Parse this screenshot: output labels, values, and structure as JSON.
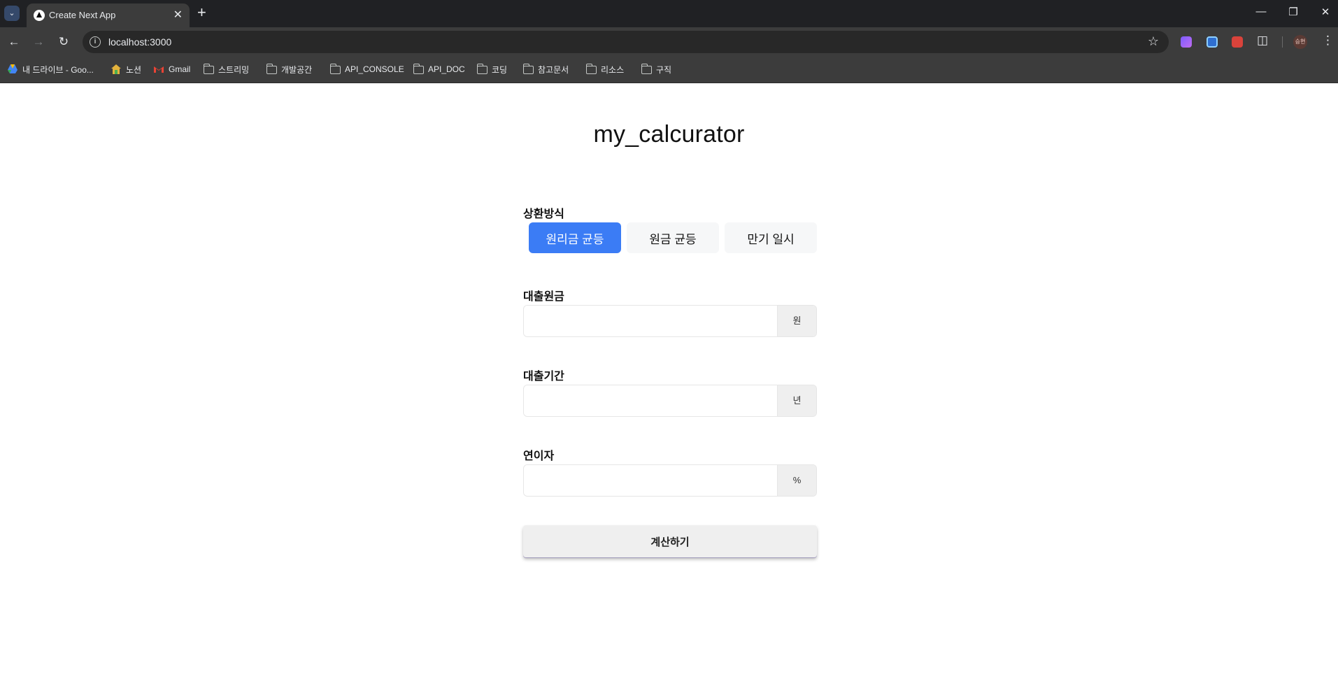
{
  "browser": {
    "tab_title": "Create Next App",
    "url": "localhost:3000",
    "profile_initials": "승현",
    "bookmarks": [
      {
        "label": "내 드라이브 - Goo...",
        "icon": "google-drive-icon"
      },
      {
        "label": "노션",
        "icon": "notion-icon"
      },
      {
        "label": "Gmail",
        "icon": "gmail-icon"
      },
      {
        "label": "스트리밍",
        "icon": "folder-icon"
      },
      {
        "label": "개발공간",
        "icon": "folder-icon"
      },
      {
        "label": "API_CONSOLE",
        "icon": "folder-icon"
      },
      {
        "label": "API_DOC",
        "icon": "folder-icon"
      },
      {
        "label": "코딩",
        "icon": "folder-icon"
      },
      {
        "label": "참고문서",
        "icon": "folder-icon"
      },
      {
        "label": "리소스",
        "icon": "folder-icon"
      },
      {
        "label": "구직",
        "icon": "folder-icon"
      }
    ]
  },
  "app": {
    "title": "my_calcurator",
    "repayment": {
      "label": "상환방식",
      "options": [
        "원리금 균등",
        "원금 균등",
        "만기 일시"
      ],
      "selected": "원리금 균등"
    },
    "principal": {
      "label": "대출원금",
      "value": "",
      "unit": "원"
    },
    "period": {
      "label": "대출기간",
      "value": "",
      "unit": "년"
    },
    "rate": {
      "label": "연이자",
      "value": "",
      "unit": "%"
    },
    "submit_label": "계산하기"
  },
  "colors": {
    "accent": "#3b7cf5",
    "chrome_dark": "#202124",
    "chrome_toolbar": "#3c3c3c"
  }
}
